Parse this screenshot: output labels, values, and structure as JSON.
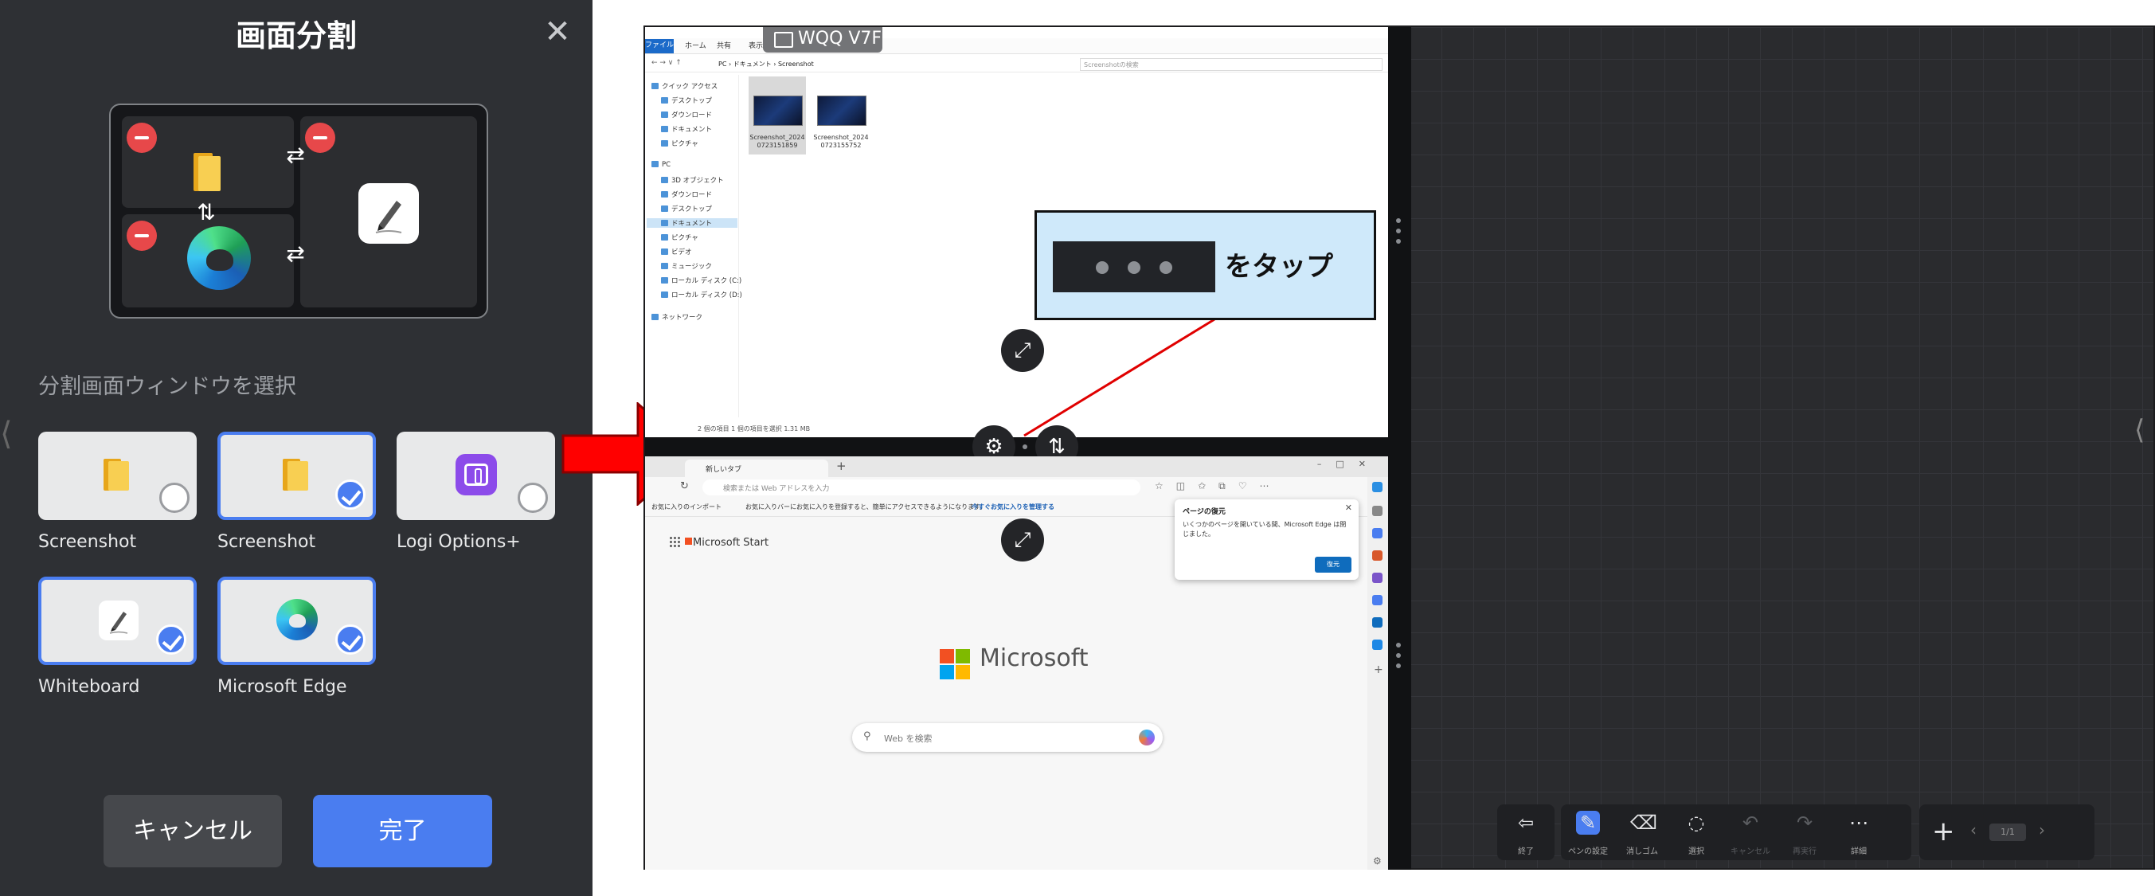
{
  "panel": {
    "title": "画面分割",
    "select_label": "分割画面ウィンドウを選択",
    "cancel": "キャンセル",
    "done": "完了",
    "tiles": [
      {
        "label": "Screenshot",
        "icon": "folder-icon",
        "selected": false
      },
      {
        "label": "Screenshot",
        "icon": "folder-icon",
        "selected": true
      },
      {
        "label": "Logi Options+",
        "icon": "logi-options-icon",
        "selected": false
      },
      {
        "label": "Whiteboard",
        "icon": "whiteboard-icon",
        "selected": true
      },
      {
        "label": "Microsoft Edge",
        "icon": "edge-icon",
        "selected": true
      }
    ]
  },
  "explorer": {
    "ribbon_tabs": [
      "ファイル",
      "ホーム",
      "共有",
      "表示"
    ],
    "path": "PC › ドキュメント › Screenshot",
    "search_placeholder": "Screenshotの検索",
    "nav": [
      "クイック アクセス",
      "デスクトップ",
      "ダウンロード",
      "ドキュメント",
      "ピクチャ",
      "PC",
      "3D オブジェクト",
      "ダウンロード",
      "デスクトップ",
      "ドキュメント",
      "ピクチャ",
      "ビデオ",
      "ミュージック",
      "ローカル ディスク (C:)",
      "ローカル ディスク (D:)",
      "ネットワーク"
    ],
    "files": [
      "Screenshot_20240723151859",
      "Screenshot_20240723155752"
    ],
    "status": "2 個の項目   1 個の項目を選択  1.31 MB"
  },
  "chip": "WQQ V7F",
  "callout": "をタップ",
  "edge": {
    "tab_title": "新しいタブ",
    "url_placeholder": "検索または Web アドレスを入力",
    "fav_import": "お気に入りのインポート",
    "fav_text": "お気に入りバーにお気に入りを登録すると、簡単にアクセスできるようになります。",
    "fav_link": "今すぐお気に入りを管理する",
    "ms_start": "Microsoft Start",
    "ms_word": "Microsoft",
    "search_placeholder": "Web を検索",
    "popup_title": "ページの復元",
    "popup_body": "いくつかのページを開いている間、Microsoft Edge は閉じました。",
    "popup_button": "復元"
  },
  "toolbar": {
    "items": [
      {
        "label": "終了",
        "icon": "exit-icon"
      },
      {
        "label": "ペンの設定",
        "icon": "pen-icon"
      },
      {
        "label": "消しゴム",
        "icon": "eraser-icon"
      },
      {
        "label": "選択",
        "icon": "lasso-icon"
      },
      {
        "label": "キャンセル",
        "icon": "undo-icon"
      },
      {
        "label": "再実行",
        "icon": "redo-icon"
      },
      {
        "label": "詳細",
        "icon": "more-icon"
      }
    ],
    "page": "1/1"
  },
  "colors": {
    "accent": "#4a7df0",
    "remove": "#e7484a",
    "panel_bg": "#2e3034",
    "arrow": "#ff0000"
  }
}
